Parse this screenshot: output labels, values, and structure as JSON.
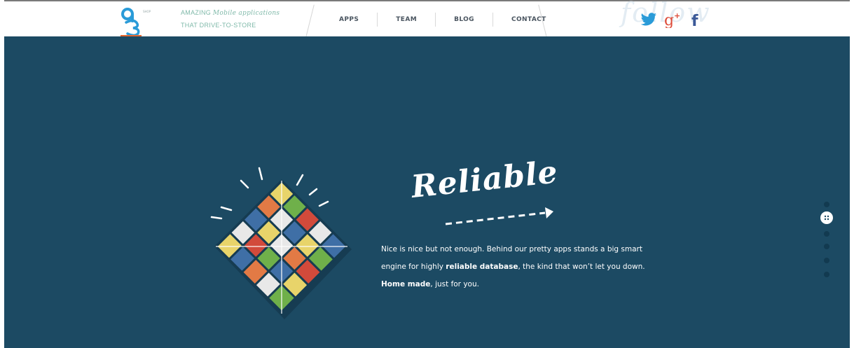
{
  "header": {
    "logo_text": "q3",
    "logo_superscript": "SHOP",
    "tagline_prefix": "AMAZING",
    "tagline_script": "Mobile applications",
    "tagline_line2": "THAT DRIVE-TO-STORE",
    "nav": [
      {
        "label": "APPS"
      },
      {
        "label": "TEAM"
      },
      {
        "label": "BLOG"
      },
      {
        "label": "CONTACT"
      }
    ],
    "social": [
      {
        "icon": "twitter-icon",
        "glyph": "🐦"
      },
      {
        "icon": "google-plus-icon",
        "glyph": "8+"
      },
      {
        "icon": "facebook-icon",
        "glyph": "f"
      }
    ]
  },
  "hero": {
    "title": "Reliable",
    "text_1": "Nice is nice but not enough. Behind our pretty apps stands a big smart engine for highly ",
    "text_bold_1": "reliable database",
    "text_2": ", the kind that won’t let you down. ",
    "text_bold_2": "Home made",
    "text_3": ", just for you."
  },
  "pager": {
    "count": 6,
    "active_index": 0
  },
  "colors": {
    "hero_bg": "#1c4a63",
    "accent_orange": "#e8672f",
    "twitter_blue": "#2a9bd8",
    "google_red": "#dd4b39",
    "facebook_blue": "#3b5998",
    "tagline_green": "#7fb9a9"
  }
}
